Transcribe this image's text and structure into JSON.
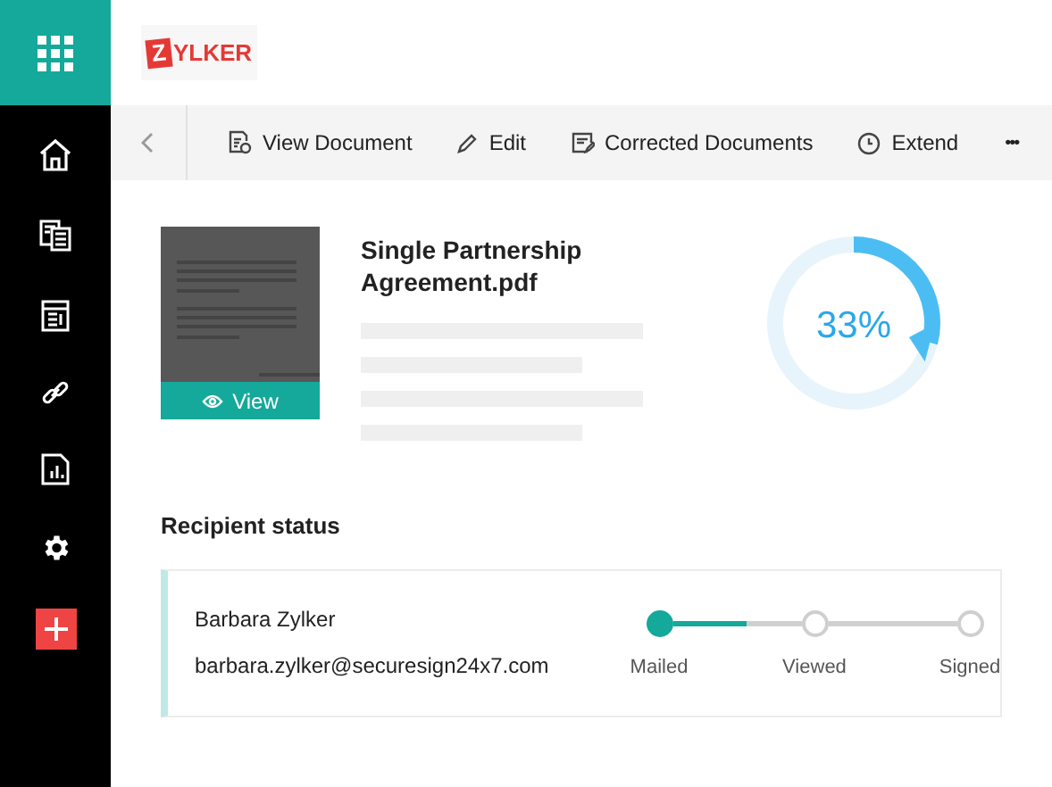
{
  "logo": {
    "mark": "Z",
    "text": "YLKER"
  },
  "toolbar": {
    "actions": [
      {
        "kind": "view",
        "label": "View Document"
      },
      {
        "kind": "edit",
        "label": "Edit"
      },
      {
        "kind": "corrected",
        "label": "Corrected Documents"
      },
      {
        "kind": "extend",
        "label": "Extend"
      }
    ],
    "more": "•••"
  },
  "document": {
    "name": "Single Partnership Agreement.pdf",
    "view_button": "View"
  },
  "progress": {
    "label": "33%"
  },
  "recipient_status": {
    "title": "Recipient status",
    "recipients": [
      {
        "name": "Barbara Zylker",
        "email": "barbara.zylker@securesign24x7.com",
        "level": 0.58,
        "steps": [
          {
            "label": "Mailed",
            "done": true
          },
          {
            "label": "Viewed",
            "done": false
          },
          {
            "label": "Signed",
            "done": false
          }
        ]
      }
    ]
  }
}
